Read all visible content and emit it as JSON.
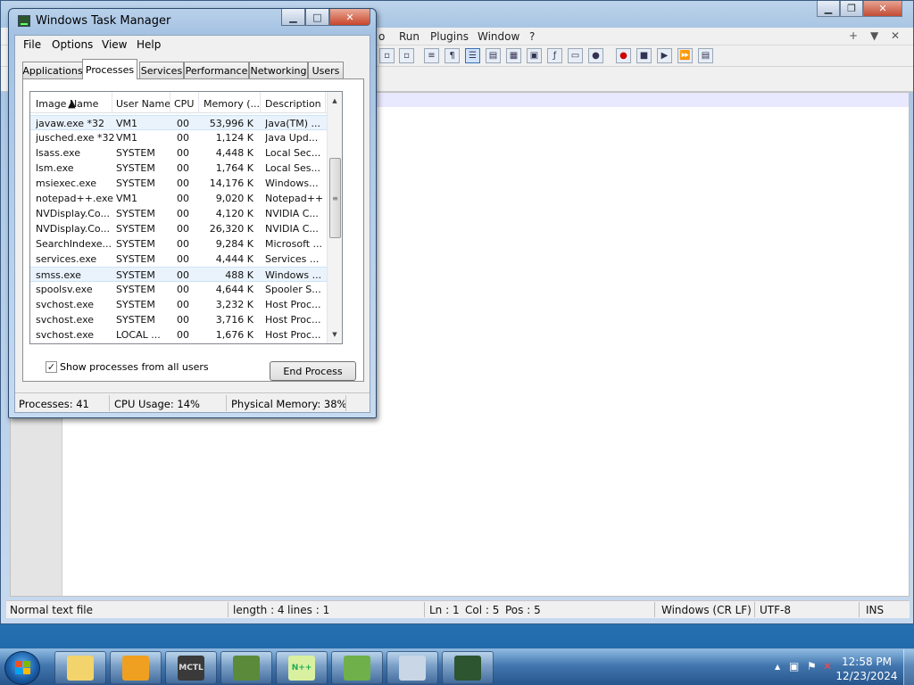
{
  "notepadpp": {
    "menu": [
      "o",
      "Run",
      "Plugins",
      "Window",
      "?"
    ],
    "menu_right": [
      "+",
      "▼",
      "✕"
    ],
    "status": {
      "filetype": "Normal text file",
      "length": "length : 4",
      "lines": "lines : 1",
      "ln": "Ln : 1",
      "col": "Col : 5",
      "pos": "Pos : 5",
      "eol": "Windows (CR LF)",
      "encoding": "UTF-8",
      "mode": "INS"
    }
  },
  "taskmanager": {
    "title": "Windows Task Manager",
    "menu": [
      "File",
      "Options",
      "View",
      "Help"
    ],
    "tabs": [
      "Applications",
      "Processes",
      "Services",
      "Performance",
      "Networking",
      "Users"
    ],
    "active_tab": "Processes",
    "columns": [
      "Image Name",
      "User Name",
      "CPU",
      "Memory (...",
      "Description"
    ],
    "rows": [
      {
        "name": "javaw.exe *32",
        "user": "VM1",
        "cpu": "00",
        "mem": "53,996 K",
        "desc": "Java(TM) ..."
      },
      {
        "name": "jusched.exe *32",
        "user": "VM1",
        "cpu": "00",
        "mem": "1,124 K",
        "desc": "Java Upd..."
      },
      {
        "name": "lsass.exe",
        "user": "SYSTEM",
        "cpu": "00",
        "mem": "4,448 K",
        "desc": "Local Sec..."
      },
      {
        "name": "lsm.exe",
        "user": "SYSTEM",
        "cpu": "00",
        "mem": "1,764 K",
        "desc": "Local Ses..."
      },
      {
        "name": "msiexec.exe",
        "user": "SYSTEM",
        "cpu": "00",
        "mem": "14,176 K",
        "desc": "Windows..."
      },
      {
        "name": "notepad++.exe",
        "user": "VM1",
        "cpu": "00",
        "mem": "9,020 K",
        "desc": "Notepad++"
      },
      {
        "name": "NVDisplay.Co...",
        "user": "SYSTEM",
        "cpu": "00",
        "mem": "4,120 K",
        "desc": "NVIDIA C..."
      },
      {
        "name": "NVDisplay.Co...",
        "user": "SYSTEM",
        "cpu": "00",
        "mem": "26,320 K",
        "desc": "NVIDIA C..."
      },
      {
        "name": "SearchIndexe...",
        "user": "SYSTEM",
        "cpu": "00",
        "mem": "9,284 K",
        "desc": "Microsoft ..."
      },
      {
        "name": "services.exe",
        "user": "SYSTEM",
        "cpu": "00",
        "mem": "4,444 K",
        "desc": "Services ..."
      },
      {
        "name": "smss.exe",
        "user": "SYSTEM",
        "cpu": "00",
        "mem": "488 K",
        "desc": "Windows ..."
      },
      {
        "name": "spoolsv.exe",
        "user": "SYSTEM",
        "cpu": "00",
        "mem": "4,644 K",
        "desc": "Spooler S..."
      },
      {
        "name": "svchost.exe",
        "user": "SYSTEM",
        "cpu": "00",
        "mem": "3,232 K",
        "desc": "Host Proc..."
      },
      {
        "name": "svchost.exe",
        "user": "SYSTEM",
        "cpu": "00",
        "mem": "3,716 K",
        "desc": "Host Proc..."
      },
      {
        "name": "svchost.exe",
        "user": "LOCAL ...",
        "cpu": "00",
        "mem": "1,676 K",
        "desc": "Host Proc..."
      }
    ],
    "show_all_label": "Show processes from all users",
    "show_all_checked": "✓",
    "end_process": "End Process",
    "status": {
      "processes": "Processes: 41",
      "cpu": "CPU Usage: 14%",
      "memory": "Physical Memory: 38%"
    }
  },
  "taskbar": {
    "apps": [
      {
        "name": "file-explorer-icon",
        "text": ""
      },
      {
        "name": "media-player-icon",
        "text": ""
      },
      {
        "name": "minecraft-launcher-icon",
        "text": "MCTL"
      },
      {
        "name": "minecraft-icon",
        "text": ""
      },
      {
        "name": "notepadpp-icon",
        "text": "N++"
      },
      {
        "name": "frog-app-icon",
        "text": ""
      },
      {
        "name": "calculator-icon",
        "text": ""
      },
      {
        "name": "task-manager-icon",
        "text": ""
      }
    ],
    "clock": {
      "time": "12:58 PM",
      "date": "12/23/2024"
    }
  }
}
